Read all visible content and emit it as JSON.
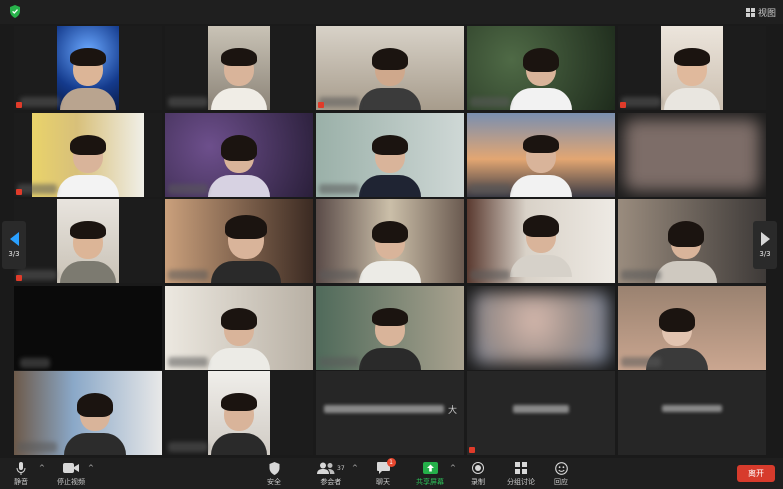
{
  "topbar": {
    "view_label": "视图"
  },
  "gallery": {
    "pager_left": "3/3",
    "pager_right": "3/3",
    "text_tiles": [
      {
        "name": "大"
      }
    ]
  },
  "toolbar": {
    "mute_label": "静音",
    "stop_video_label": "停止视频",
    "security_label": "安全",
    "participants_label": "参会者",
    "participants_count": "37",
    "chat_label": "聊天",
    "chat_badge": "1",
    "share_label": "共享屏幕",
    "record_label": "录制",
    "breakout_label": "分组讨论",
    "reactions_label": "回应",
    "leave_label": "离开"
  }
}
